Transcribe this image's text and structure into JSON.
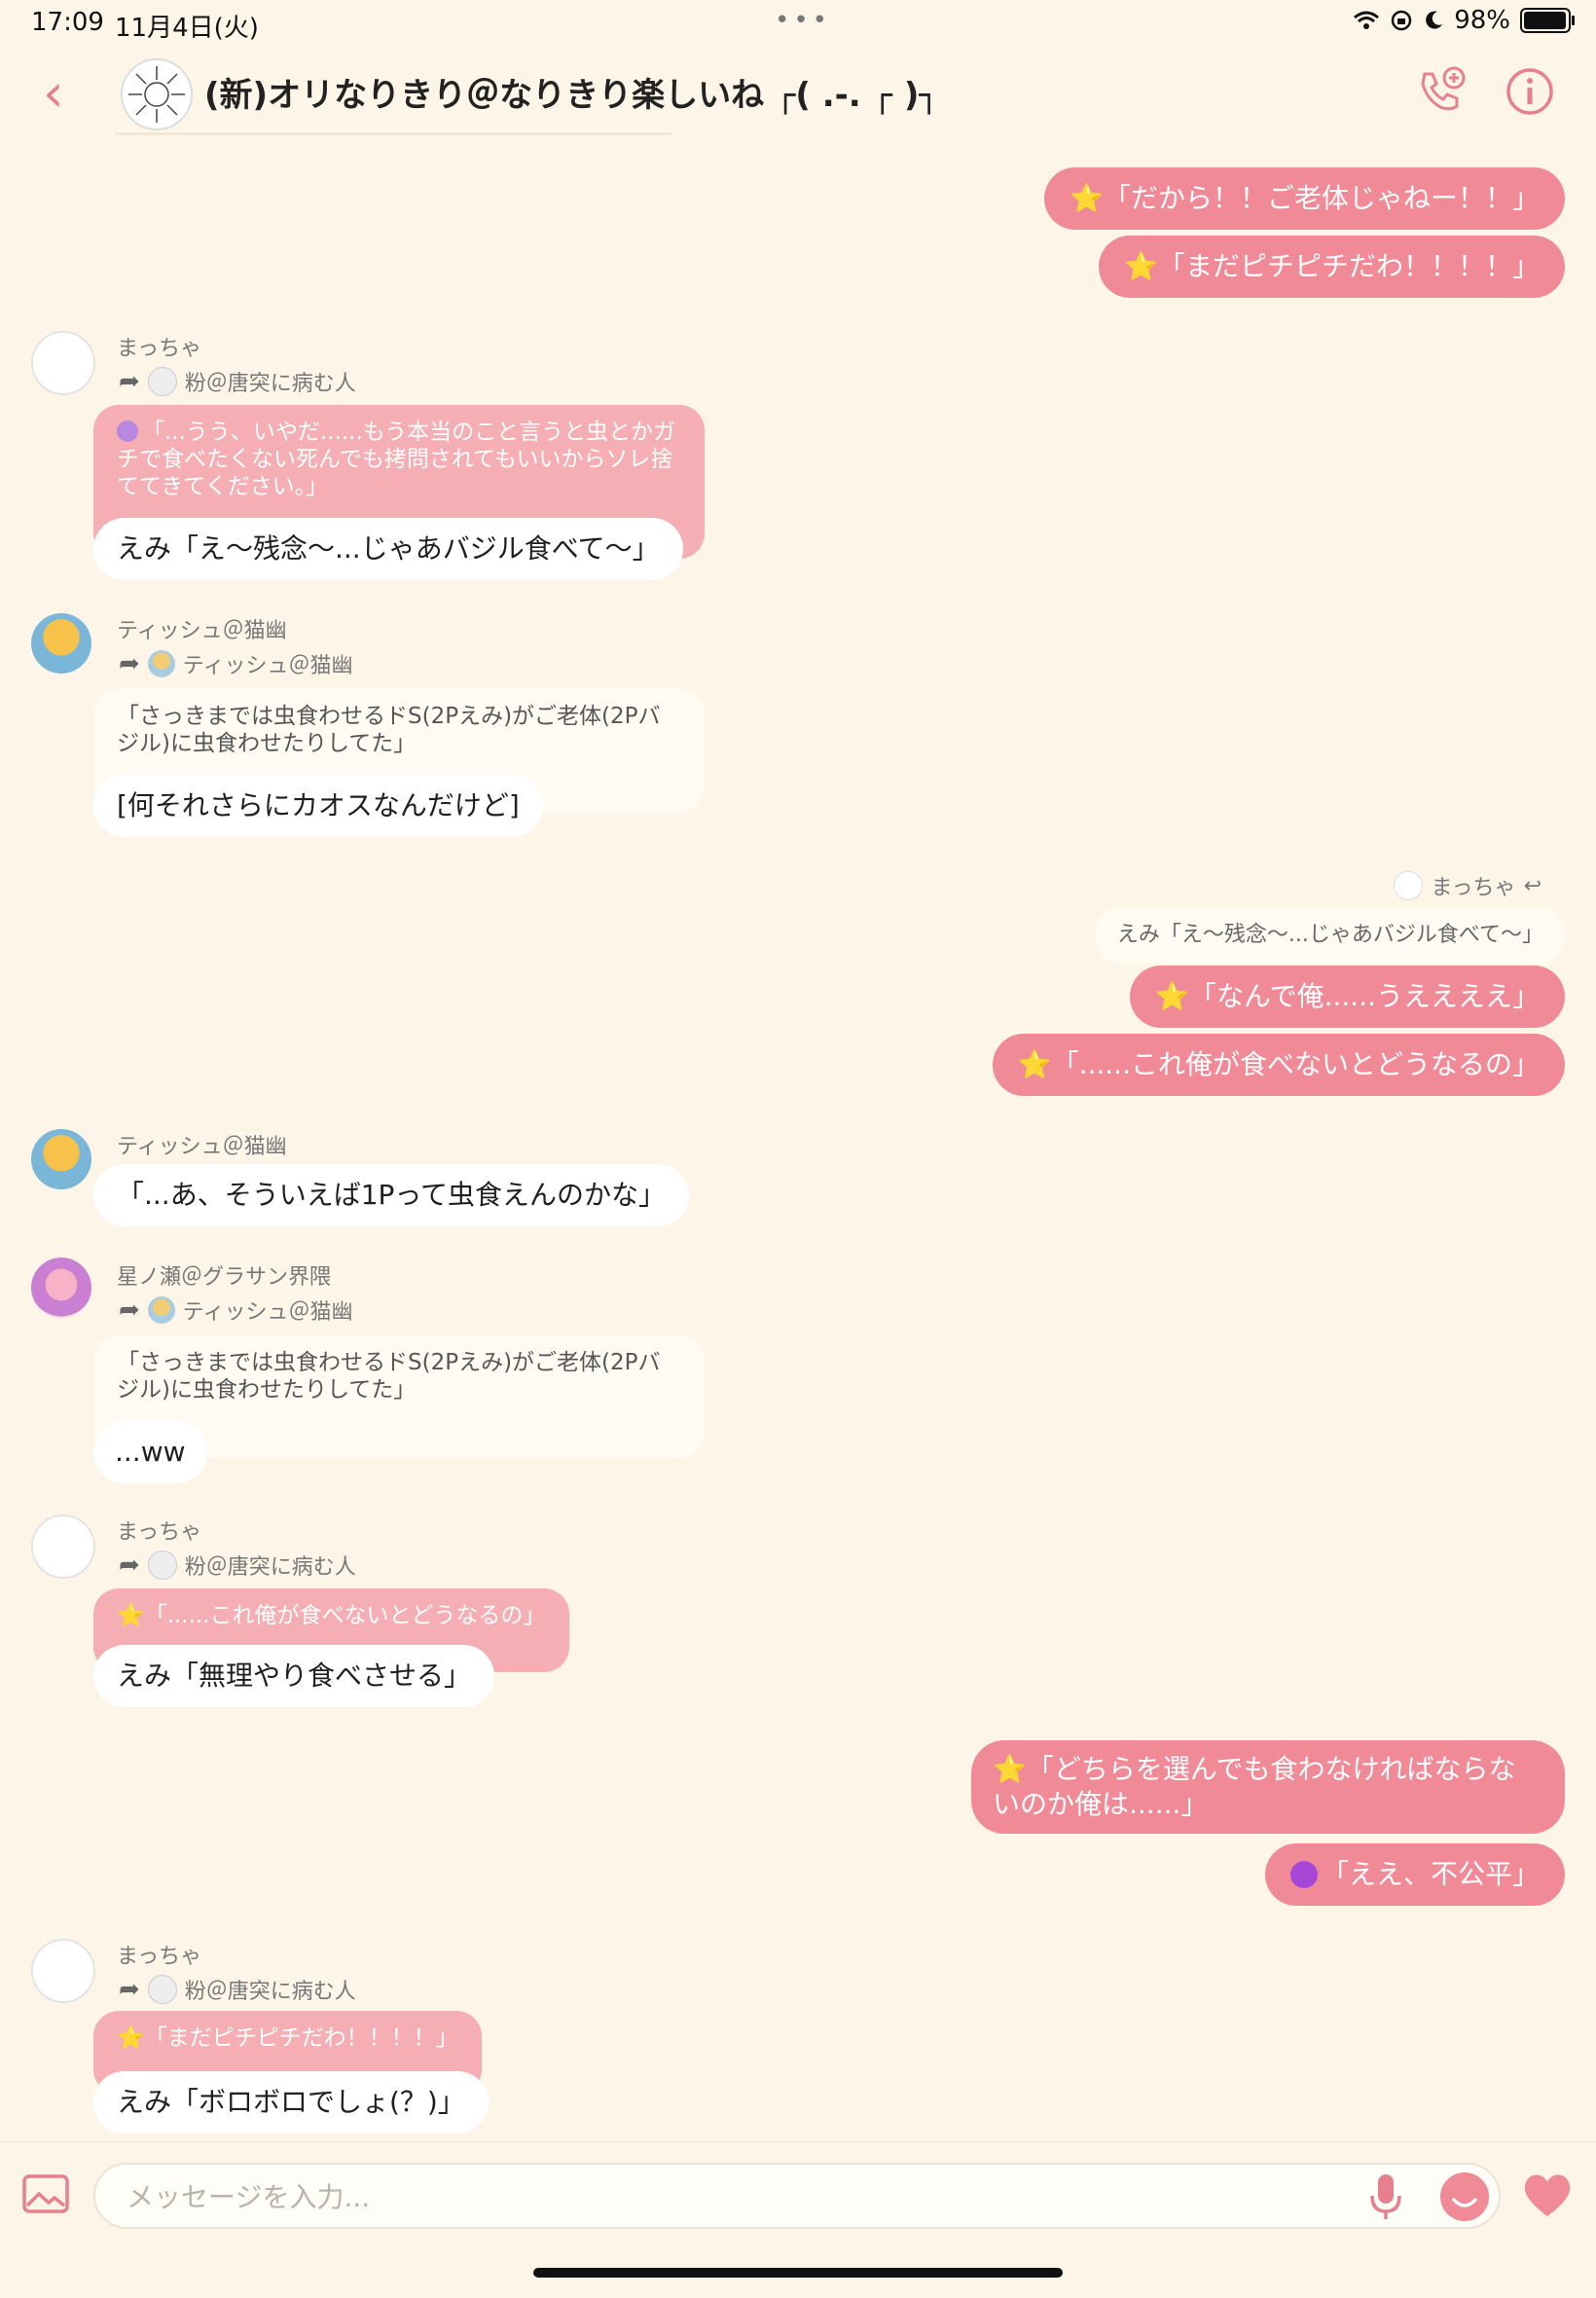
{
  "status_bar": {
    "time": "17:09",
    "date": "11月4日(火)",
    "battery": "98%"
  },
  "header": {
    "title": "(新)オリなりきり＠なりきり楽しいね ┌( .-. ┌ )┐"
  },
  "messages": {
    "m1": {
      "text": "⭐「だから！！ご老体じゃねー！！」"
    },
    "m2": {
      "text": "⭐「まだピチピチだわ！！！！」"
    },
    "g1": {
      "sender": "まっちゃ",
      "forward_from": "粉＠唐突に病む人",
      "quote": "「...うう、いやだ......もう本当のこと言うと虫とかガチで食べたくない死んでも拷問されてもいいからソレ捨ててきてください。」",
      "text": "えみ「え〜残念〜...じゃあバジル食べて〜」"
    },
    "g2": {
      "sender": "ティッシュ＠猫幽",
      "forward_from": "ティッシュ＠猫幽",
      "quote": "「さっきまでは虫食わせるドS(2Pえみ)がご老体(2Pバジル)に虫食わせたりしてた」",
      "text": "[何それさらにカオスなんだけど]"
    },
    "r1": {
      "reply_to": "まっちゃ",
      "reply_quote": "えみ「え〜残念〜...じゃあバジル食べて〜」",
      "text1": "⭐「なんで俺......うええええ」",
      "text2": "⭐「......これ俺が食べないとどうなるの」"
    },
    "g3": {
      "sender": "ティッシュ＠猫幽",
      "text": "「...あ、そういえば1Pって虫食えんのかな」"
    },
    "g4": {
      "sender": "星ノ瀬＠グラサン界隈",
      "forward_from": "ティッシュ＠猫幽",
      "quote": "「さっきまでは虫食わせるドS(2Pえみ)がご老体(2Pバジル)に虫食わせたりしてた」",
      "text": "...ww"
    },
    "g5": {
      "sender": "まっちゃ",
      "forward_from": "粉＠唐突に病む人",
      "quote": "⭐「......これ俺が食べないとどうなるの」",
      "text": "えみ「無理やり食べさせる」"
    },
    "m3": {
      "text": "⭐「どちらを選んでも食わなければならないのか俺は......」"
    },
    "m4": {
      "text": "「ええ、不公平」"
    },
    "g6": {
      "sender": "まっちゃ",
      "forward_from": "粉＠唐突に病む人",
      "quote": "⭐「まだピチピチだわ！！！！」",
      "text": "えみ「ボロボロでしょ(？)」"
    }
  },
  "input": {
    "placeholder": "メッセージを入力..."
  }
}
